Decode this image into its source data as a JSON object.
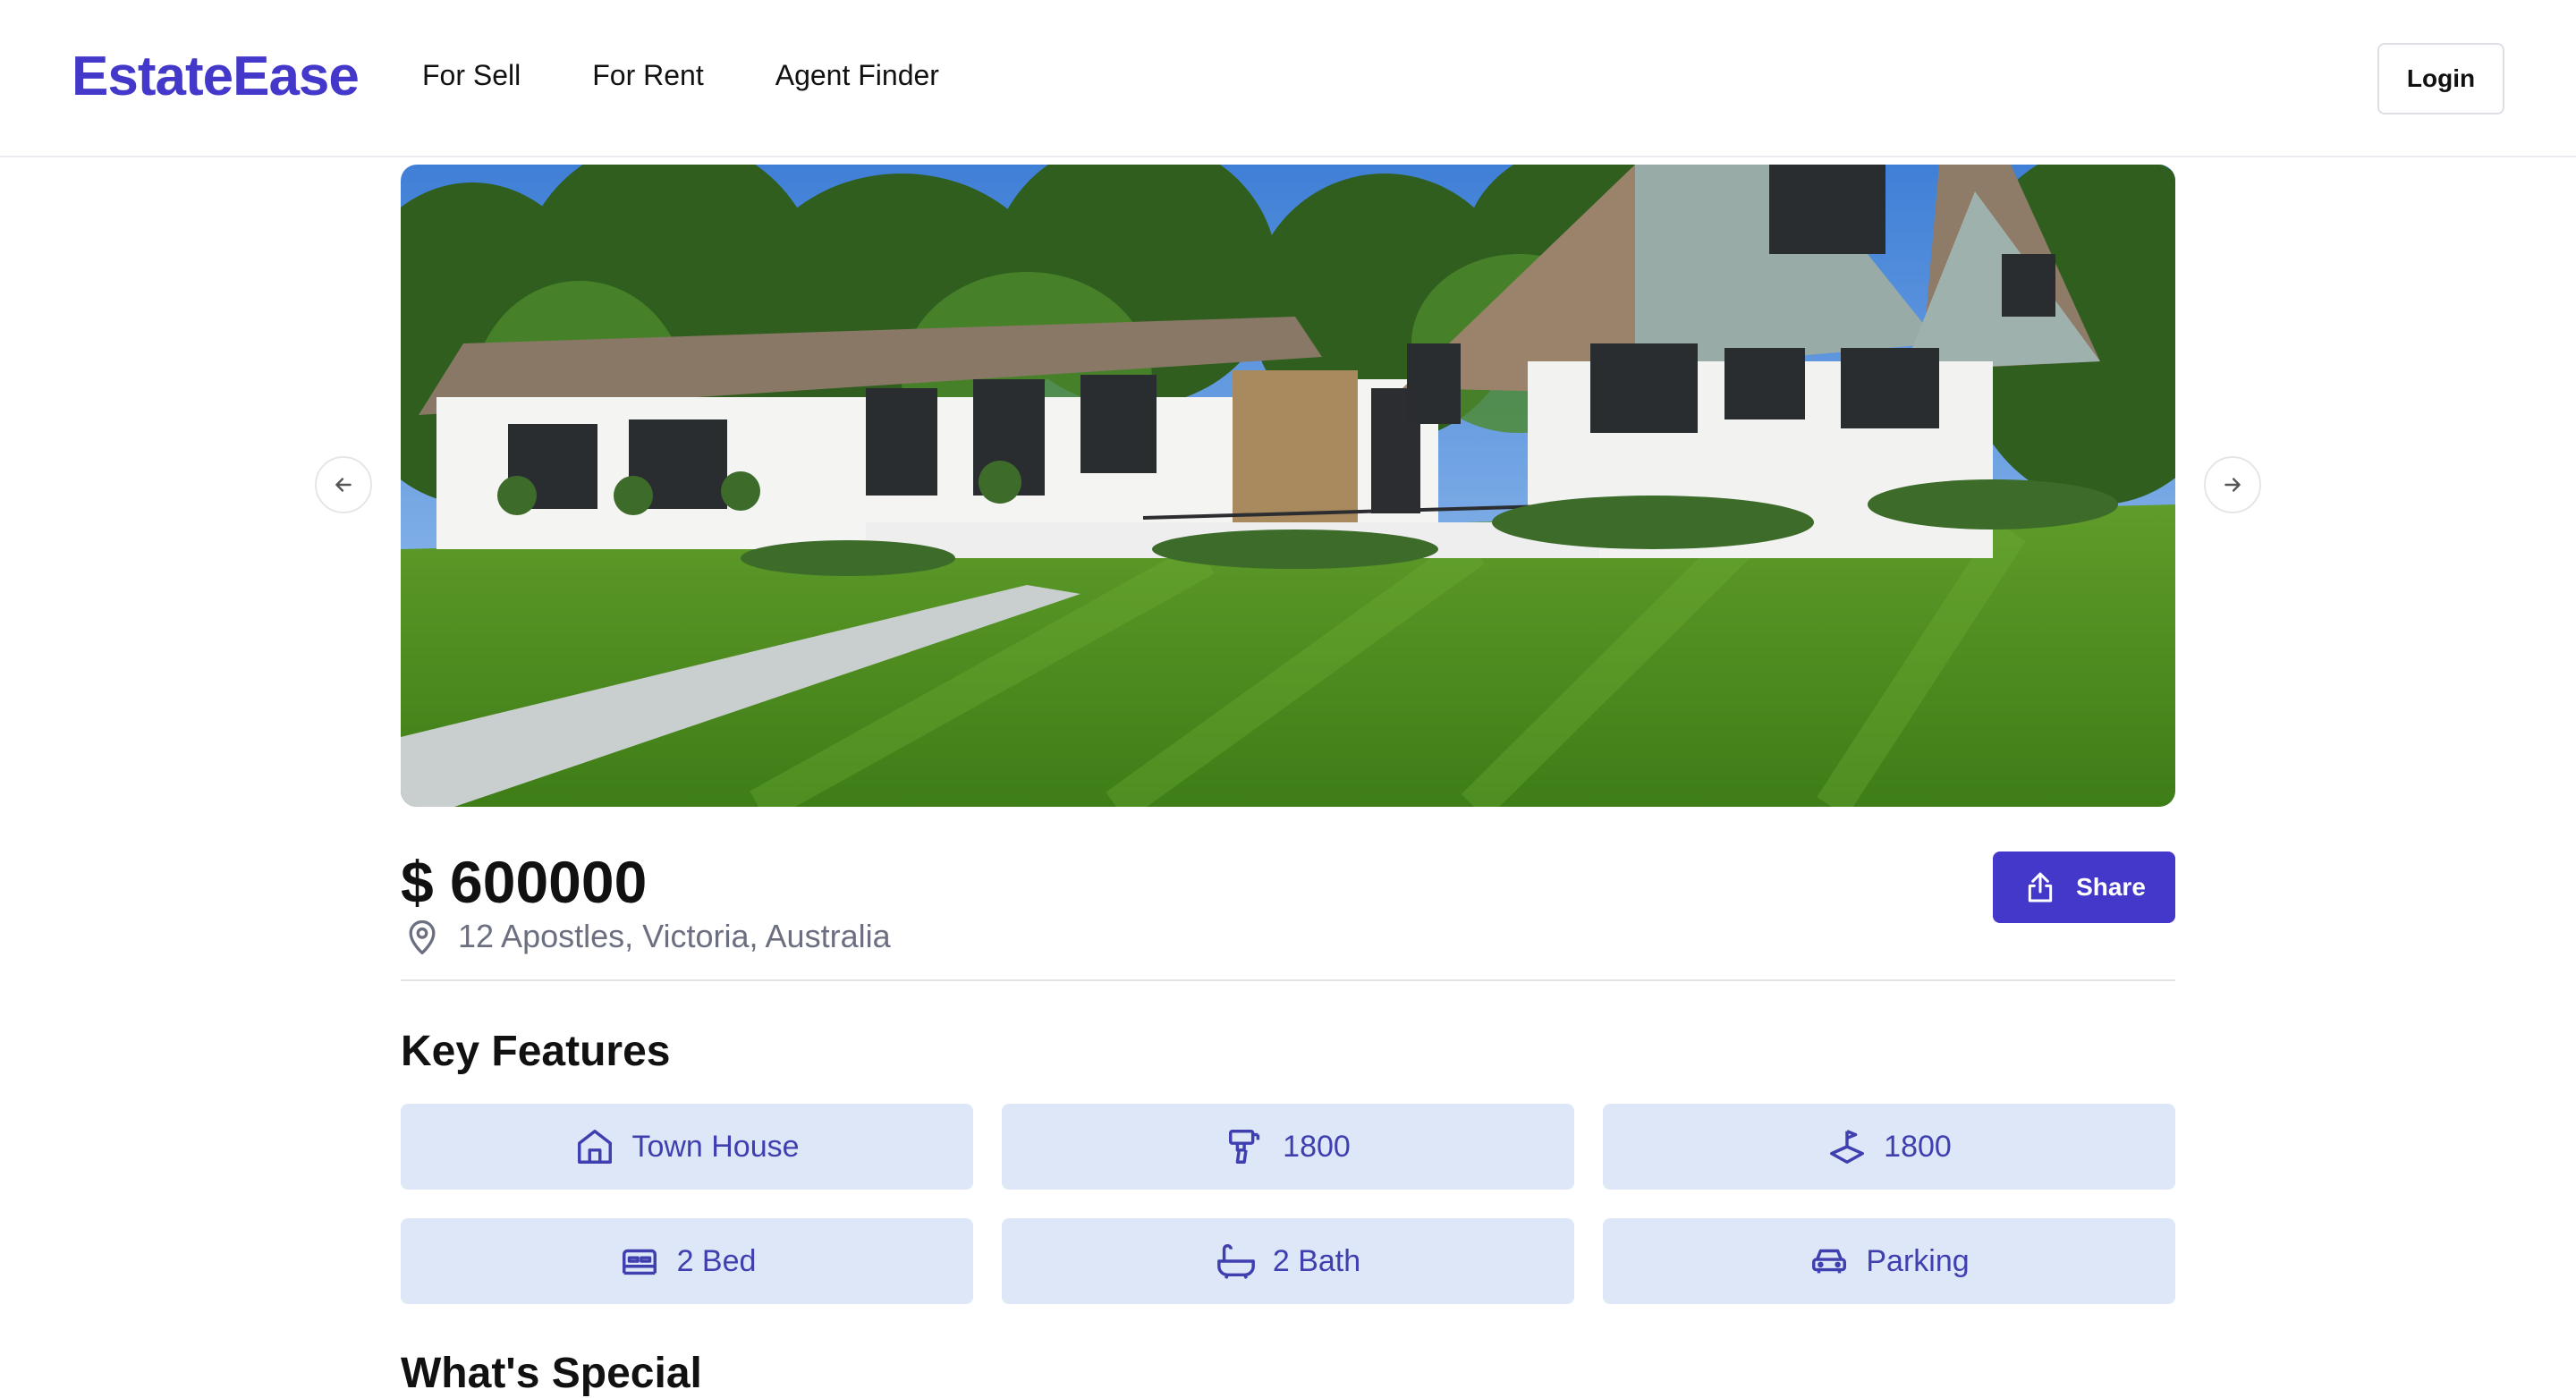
{
  "brand": {
    "name": "EstateEase",
    "color": "#4338ca"
  },
  "nav": {
    "items": [
      "For Sell",
      "For Rent",
      "Agent Finder"
    ]
  },
  "header": {
    "login_label": "Login"
  },
  "listing": {
    "price": "$ 600000",
    "address": "12 Apostles, Victoria, Australia",
    "share_label": "Share"
  },
  "sections": {
    "key_features": "Key Features",
    "whats_special": "What's Special"
  },
  "features": [
    {
      "icon": "house-icon",
      "label": "Town House"
    },
    {
      "icon": "drill-icon",
      "label": "1800"
    },
    {
      "icon": "land-area-icon",
      "label": "1800"
    },
    {
      "icon": "bed-icon",
      "label": "2 Bed"
    },
    {
      "icon": "bath-icon",
      "label": "2 Bath"
    },
    {
      "icon": "car-icon",
      "label": "Parking"
    }
  ],
  "colors": {
    "accent": "#4338ca",
    "tile_bg": "#dde7f8",
    "tile_text": "#3f3fb0"
  }
}
